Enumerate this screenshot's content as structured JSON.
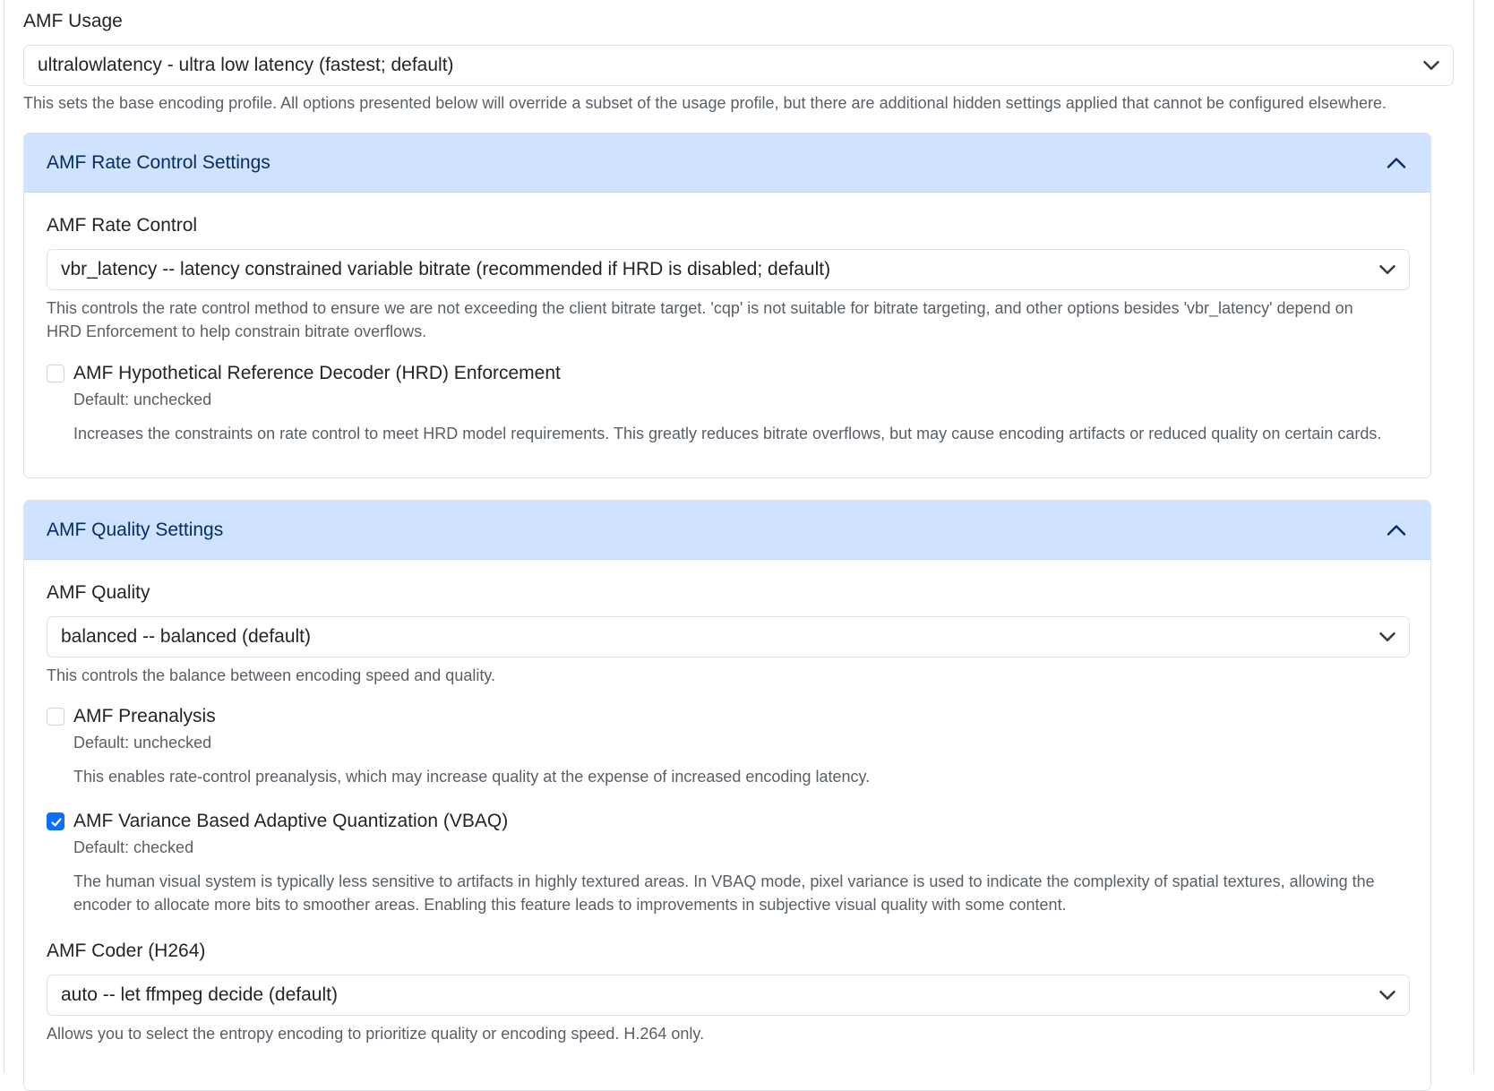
{
  "usage": {
    "label": "AMF Usage",
    "selected": "ultralowlatency - ultra low latency (fastest; default)",
    "help": "This sets the base encoding profile. All options presented below will override a subset of the usage profile, but there are additional hidden settings applied that cannot be configured elsewhere."
  },
  "rate_control_section": {
    "title": "AMF Rate Control Settings",
    "rate_control": {
      "label": "AMF Rate Control",
      "selected": "vbr_latency -- latency constrained variable bitrate (recommended if HRD is disabled; default)",
      "help": "This controls the rate control method to ensure we are not exceeding the client bitrate target. 'cqp' is not suitable for bitrate targeting, and other options besides 'vbr_latency' depend on HRD Enforcement to help constrain bitrate overflows."
    },
    "hrd": {
      "label": "AMF Hypothetical Reference Decoder (HRD) Enforcement",
      "default_text": "Default: unchecked",
      "description": "Increases the constraints on rate control to meet HRD model requirements. This greatly reduces bitrate overflows, but may cause encoding artifacts or reduced quality on certain cards.",
      "checked": false
    }
  },
  "quality_section": {
    "title": "AMF Quality Settings",
    "quality": {
      "label": "AMF Quality",
      "selected": "balanced -- balanced (default)",
      "help": "This controls the balance between encoding speed and quality."
    },
    "preanalysis": {
      "label": "AMF Preanalysis",
      "default_text": "Default: unchecked",
      "description": "This enables rate-control preanalysis, which may increase quality at the expense of increased encoding latency.",
      "checked": false
    },
    "vbaq": {
      "label": "AMF Variance Based Adaptive Quantization (VBAQ)",
      "default_text": "Default: checked",
      "description": "The human visual system is typically less sensitive to artifacts in highly textured areas. In VBAQ mode, pixel variance is used to indicate the complexity of spatial textures, allowing the encoder to allocate more bits to smoother areas. Enabling this feature leads to improvements in subjective visual quality with some content.",
      "checked": true
    },
    "coder": {
      "label": "AMF Coder (H264)",
      "selected": "auto -- let ffmpeg decide (default)",
      "help": "Allows you to select the entropy encoding to prioritize quality or encoding speed. H.264 only."
    }
  },
  "colors": {
    "accent": "#0d6efd",
    "card_header_bg": "#cfe2ff",
    "card_header_text": "#052c65"
  }
}
